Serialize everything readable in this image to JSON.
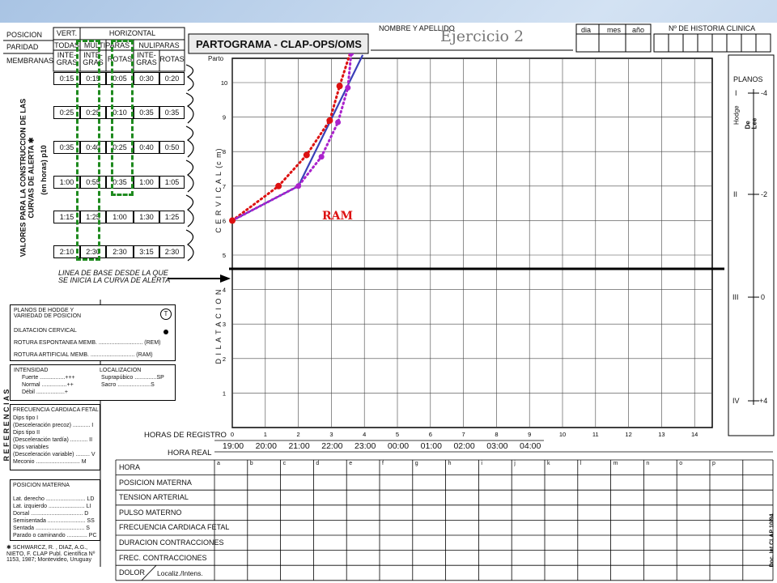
{
  "header": {
    "posicion": "POSICION",
    "paridad": "PARIDAD",
    "membranas": "MEMBRANAS",
    "vert": "VERT.",
    "horizontal": "HORIZONTAL",
    "todas": "TODAS",
    "multiparas": "MULTIPARAS",
    "nuliparas": "NULIPARAS",
    "integras": "INTE-GRAS",
    "rotas": "ROTAS",
    "title": "PARTOGRAMA - CLAP-OPS/OMS",
    "nombre": "NOMBRE Y APELLIDO",
    "exercise": "Ejercicio 2",
    "dia": "dia",
    "mes": "mes",
    "anio": "año",
    "historia": "Nº DE HISTORIA CLINICA"
  },
  "alert_table": {
    "rows": [
      [
        "0:15",
        "0:15",
        "0:05",
        "0:30",
        "0:20"
      ],
      [
        "0:25",
        "0:25",
        "0:10",
        "0:35",
        "0:35"
      ],
      [
        "0:35",
        "0:40",
        "0:25",
        "0:40",
        "0:50"
      ],
      [
        "1:00",
        "0:55",
        "0:35",
        "1:00",
        "1:05"
      ],
      [
        "1:15",
        "1:25",
        "1:00",
        "1:30",
        "1:25"
      ],
      [
        "2:10",
        "2:30",
        "2:30",
        "3:15",
        "2:30"
      ]
    ],
    "side_label": "VALORES PARA LA CONSTRUCCION DE LAS CURVAS DE ALERTA ✱",
    "side_label2": "(en horas) p10",
    "baseline": "LINEA DE BASE DESDE LA QUE SE INICIA LA CURVA DE ALERTA"
  },
  "chart_data": {
    "type": "line",
    "x_label_top": "HORAS DE REGISTRO",
    "x_label_real": "HORA REAL",
    "y_label_top": "C E R V I C A L (c m)",
    "y_label_bottom": "D I L A T A C I O N",
    "y_top_label": "Parto",
    "x_ticks": [
      0,
      1,
      2,
      3,
      4,
      5,
      6,
      7,
      8,
      9,
      10,
      11,
      12,
      13,
      14
    ],
    "y_ticks": [
      10,
      9,
      8,
      7,
      6,
      5,
      4,
      3,
      2,
      1
    ],
    "xlim": [
      0,
      15
    ],
    "ylim": [
      0,
      10
    ],
    "real_times": [
      "19:00",
      "20:00",
      "21:00",
      "22:00",
      "23:00",
      "00:00",
      "01:00",
      "02:00",
      "03:00",
      "04:00"
    ],
    "annotation": "RAM",
    "series": [
      {
        "color": "#3a3fb8",
        "style": "solid",
        "x": [
          0,
          2,
          3.95
        ],
        "y": [
          6,
          7,
          10.8
        ]
      },
      {
        "color": "#dd1111",
        "style": "dotted",
        "x": [
          0,
          1.4,
          2.25,
          2.95,
          3.25,
          3.55
        ],
        "y": [
          6,
          7,
          7.9,
          8.9,
          9.9,
          10.8
        ]
      },
      {
        "color": "#aa22cc",
        "style": "dotted",
        "x": [
          0,
          2,
          2.7,
          3.2,
          3.5,
          3.6
        ],
        "y": [
          6,
          7,
          7.85,
          8.85,
          9.85,
          10.85
        ]
      }
    ],
    "red_points": {
      "x": [
        0,
        1.4,
        2.25,
        2.95,
        3.25
      ],
      "y": [
        6,
        7,
        7.9,
        8.9,
        9.9
      ]
    },
    "purple_points": {
      "x": [
        2,
        2.7,
        3.2,
        3.5,
        3.6
      ],
      "y": [
        7,
        7.85,
        8.85,
        9.85,
        10.85
      ]
    }
  },
  "planos": {
    "title": "PLANOS",
    "hodge": "Hodge",
    "delee": "De Lee",
    "rows": [
      {
        "hodge": "I",
        "delee": "-4"
      },
      {
        "hodge": "II",
        "delee": "-2"
      },
      {
        "hodge": "III",
        "delee": "0"
      },
      {
        "hodge": "IV",
        "delee": "+4"
      }
    ]
  },
  "referencias": "R E F E R E N C I A S",
  "legend1": {
    "rows": [
      "PLANOS DE HODGE Y VARIEDAD DE POSICION",
      "DILATACION CERVICAL",
      "ROTURA ESPONTANEA MEMB. ............................ (REM)",
      "ROTURA ARTIFICIAL MEMB. ............................ (RAM)"
    ]
  },
  "legend2": {
    "intensidad": "INTENSIDAD",
    "localizacion": "LOCALIZACION",
    "rows": [
      "Fuerte ................+++",
      "Normal ................++",
      "Débil ..................+"
    ],
    "loc_rows": [
      "Suprapúbico ..............SP",
      "Sacro .....................S"
    ]
  },
  "legend3": {
    "title": "FRECUENCIA CARDIACA FETAL",
    "rows": [
      "Dips tipo I",
      "(Desceleración precoz) ........... I",
      "Dips tipo II",
      "(Desceleración tardía) ........... II",
      "Dips variables",
      "(Desceleración variable) ......... V",
      "Meconio ............................ M"
    ]
  },
  "legend4": {
    "title": "POSICION MATERNA",
    "rows": [
      "Lat. derecho ......................... LD",
      "Lat. izquierdo ....................... LI",
      "Dorsal ................................. D",
      "Semisentada ........................ SS",
      "Sentada ............................... S",
      "Parado o caminando ............. PC"
    ]
  },
  "reference_note": "✱ SCHWARCZ, R. , DIAZ, A.G., NIETO, F. CLAP Publ. Científica Nº 1153, 1987; Montevideo, Uruguay",
  "doc_code": "Doc. Int.CLAP 10/94",
  "bottom_table": {
    "letters": [
      "a",
      "b",
      "c",
      "d",
      "e",
      "f",
      "g",
      "h",
      "i",
      "j",
      "k",
      "l",
      "m",
      "n",
      "o",
      "p"
    ],
    "rows": [
      "HORA",
      "POSICION MATERNA",
      "TENSION ARTERIAL",
      "PULSO MATERNO",
      "FRECUENCIA CARDIACA FETAL",
      "DURACION CONTRACCIONES",
      "FREC. CONTRACCIONES",
      "DOLOR"
    ],
    "dolor_sub": "Localiz./Intens."
  }
}
